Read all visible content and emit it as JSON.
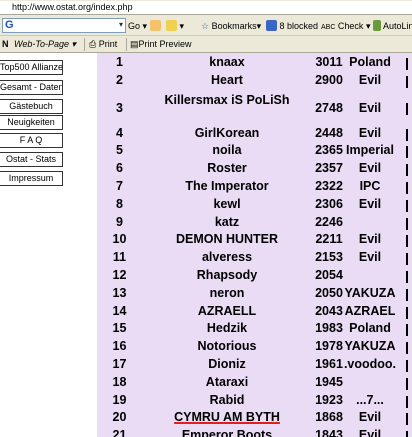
{
  "browser": {
    "url": "http://www.ostat.org/index.php",
    "google_placeholder": "G",
    "toolbar_go": "Go",
    "bookmarks_label": "Bookmarks",
    "blocked_label": "8 blocked",
    "check_label": "Check",
    "autolink_label": "AutoLin",
    "brand_fragment": "N",
    "web_to_page_label": "Web-To-Page",
    "print_label": "Print",
    "print_preview_label": "Print Preview"
  },
  "nav": {
    "items": [
      {
        "label": "Top500 Allianzen"
      },
      {
        "label": "Gesamt - Daten"
      },
      {
        "label": "Gästebuch"
      },
      {
        "label": "Neuigkeiten"
      },
      {
        "label": "F A Q"
      },
      {
        "label": "Ostat - Stats"
      },
      {
        "label": "Impressum"
      }
    ]
  },
  "ranking": {
    "rows": [
      {
        "rank": "1",
        "name": "knaax",
        "points": "3011",
        "tag": "Poland"
      },
      {
        "rank": "2",
        "name": "Heart",
        "points": "2900",
        "tag": "Evil"
      },
      {
        "rank": "3",
        "name": "Killersmax iS PoLiSh",
        "points": "2748",
        "tag": "Evil"
      },
      {
        "rank": "4",
        "name": "GirlKorean",
        "points": "2448",
        "tag": "Evil"
      },
      {
        "rank": "5",
        "name": "noila",
        "points": "2365",
        "tag": "Imperial"
      },
      {
        "rank": "6",
        "name": "Roster",
        "points": "2357",
        "tag": "Evil"
      },
      {
        "rank": "7",
        "name": "The Imperator",
        "points": "2322",
        "tag": "IPC"
      },
      {
        "rank": "8",
        "name": "kewl",
        "points": "2306",
        "tag": "Evil"
      },
      {
        "rank": "9",
        "name": "katz",
        "points": "2246",
        "tag": ""
      },
      {
        "rank": "10",
        "name": "DEMON HUNTER",
        "points": "2211",
        "tag": "Evil"
      },
      {
        "rank": "11",
        "name": "alveress",
        "points": "2153",
        "tag": "Evil"
      },
      {
        "rank": "12",
        "name": "Rhapsody",
        "points": "2054",
        "tag": ""
      },
      {
        "rank": "13",
        "name": "neron",
        "points": "2050",
        "tag": "YAKUZA"
      },
      {
        "rank": "14",
        "name": "AZRAELL",
        "points": "2043",
        "tag": "AZRAEL"
      },
      {
        "rank": "15",
        "name": "Hedzik",
        "points": "1983",
        "tag": "Poland"
      },
      {
        "rank": "16",
        "name": "Notorious",
        "points": "1978",
        "tag": "YAKUZA"
      },
      {
        "rank": "17",
        "name": "Dioniz",
        "points": "1961",
        "tag": ".voodoo."
      },
      {
        "rank": "18",
        "name": "Ataraxi",
        "points": "1945",
        "tag": ""
      },
      {
        "rank": "19",
        "name": "Rabid",
        "points": "1923",
        "tag": "...7..."
      },
      {
        "rank": "20",
        "name": "CYMRU AM BYTH",
        "points": "1868",
        "tag": "Evil"
      },
      {
        "rank": "21",
        "name": "Emperor Boots",
        "points": "1843",
        "tag": "Evil"
      }
    ]
  }
}
